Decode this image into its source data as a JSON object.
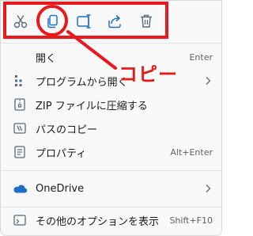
{
  "quickbar": {
    "buttons": [
      {
        "name": "cut",
        "icon": "scissors-icon"
      },
      {
        "name": "copy",
        "icon": "copy-icon"
      },
      {
        "name": "rename",
        "icon": "rename-icon"
      },
      {
        "name": "share",
        "icon": "share-icon"
      },
      {
        "name": "delete",
        "icon": "trash-icon"
      }
    ]
  },
  "annotation": {
    "label": "コピー",
    "color": "#e8191c"
  },
  "menu": {
    "items": [
      {
        "label": "開く",
        "shortcut": "Enter",
        "icon": ""
      },
      {
        "label": "プログラムから開く",
        "submenu": true,
        "icon": "open-with-icon"
      },
      {
        "label": "ZIP ファイルに圧縮する",
        "icon": "zip-icon"
      },
      {
        "label": "パスのコピー",
        "icon": "copy-path-icon"
      },
      {
        "label": "プロパティ",
        "shortcut": "Alt+Enter",
        "icon": "properties-icon"
      },
      {
        "label": "OneDrive",
        "submenu": true,
        "icon": "onedrive-icon"
      },
      {
        "label": "その他のオプションを表示",
        "shortcut": "Shift+F10",
        "icon": "more-options-icon"
      }
    ]
  },
  "colors": {
    "accent_blue": "#1f6fc5",
    "icon_gray": "#5a6a7a",
    "annotation_red": "#e8191c"
  }
}
